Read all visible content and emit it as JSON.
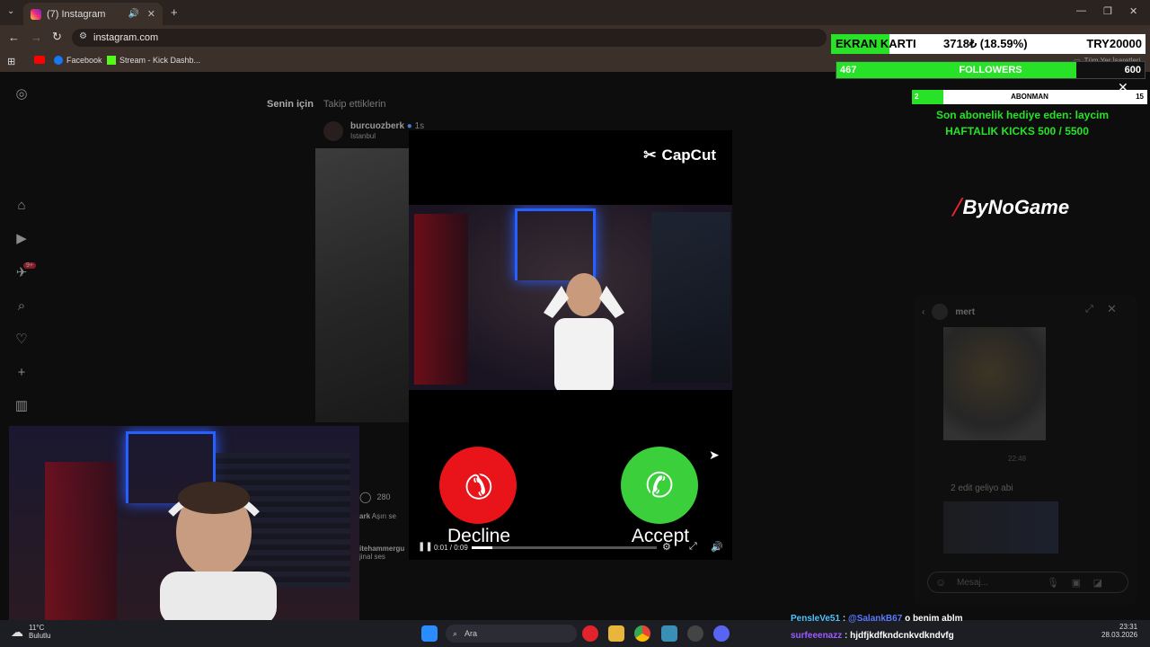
{
  "browser": {
    "tab_title": "(7) Instagram",
    "url": "instagram.com",
    "bookmarks": [
      "Facebook",
      "Stream - Kick Dashb..."
    ],
    "bookmarks_folder": "Tüm Yer İşaretleri"
  },
  "instagram": {
    "feed_tab_for_you": "Senin için",
    "feed_tab_following": "Takip ettiklerin",
    "post_username": "burcuozberk",
    "post_time": "1s",
    "post_location": "Istanbul",
    "comment_count": "280",
    "comment_user": "ark",
    "comment_text": "Aşırı se",
    "audio_user": "itehammergu",
    "audio_label": "jinal ses",
    "notification_badge": "9+"
  },
  "video": {
    "brand": "CapCut",
    "decline_label": "Decline",
    "accept_label": "Accept",
    "time": "0:01 / 0:09",
    "progress": 0.11
  },
  "overlay": {
    "ekran_label": "EKRAN KARTI",
    "ekran_value": "3718₺ (18.59%)",
    "ekran_goal": "TRY20000",
    "ekran_progress": 0.1859,
    "followers_label": "FOLLOWERS",
    "followers_current": "467",
    "followers_goal": "600",
    "followers_progress": 0.778,
    "abonman_label": "ABONMAN",
    "abonman_current": "2",
    "abonman_goal": "15",
    "abonman_progress": 0.133,
    "gift_text": "Son abonelik hediye eden: laycim",
    "kicks_text": "HAFTALIK KICKS 500 / 5500",
    "sponsor": "ByNoGame"
  },
  "dm": {
    "username": "mert",
    "timestamp": "22:48",
    "message": "2 edit geliyo abi",
    "placeholder": "Mesaj..."
  },
  "chat": [
    {
      "user": "PensleVe51",
      "mention": "@SalankB67",
      "text": "o benim ablm"
    },
    {
      "user": "surfeeenazz",
      "mention": "",
      "text": "hjdfjkdfkndcnkvdkndvfg"
    }
  ],
  "taskbar": {
    "weather_temp": "11°C",
    "weather_desc": "Bulutlu",
    "search_label": "Ara",
    "clock_time": "23:31",
    "clock_date": "28.03.2026"
  },
  "colors": {
    "accent_green": "#27e227",
    "decline_red": "#e8141a",
    "accept_green": "#3ccf3c"
  }
}
